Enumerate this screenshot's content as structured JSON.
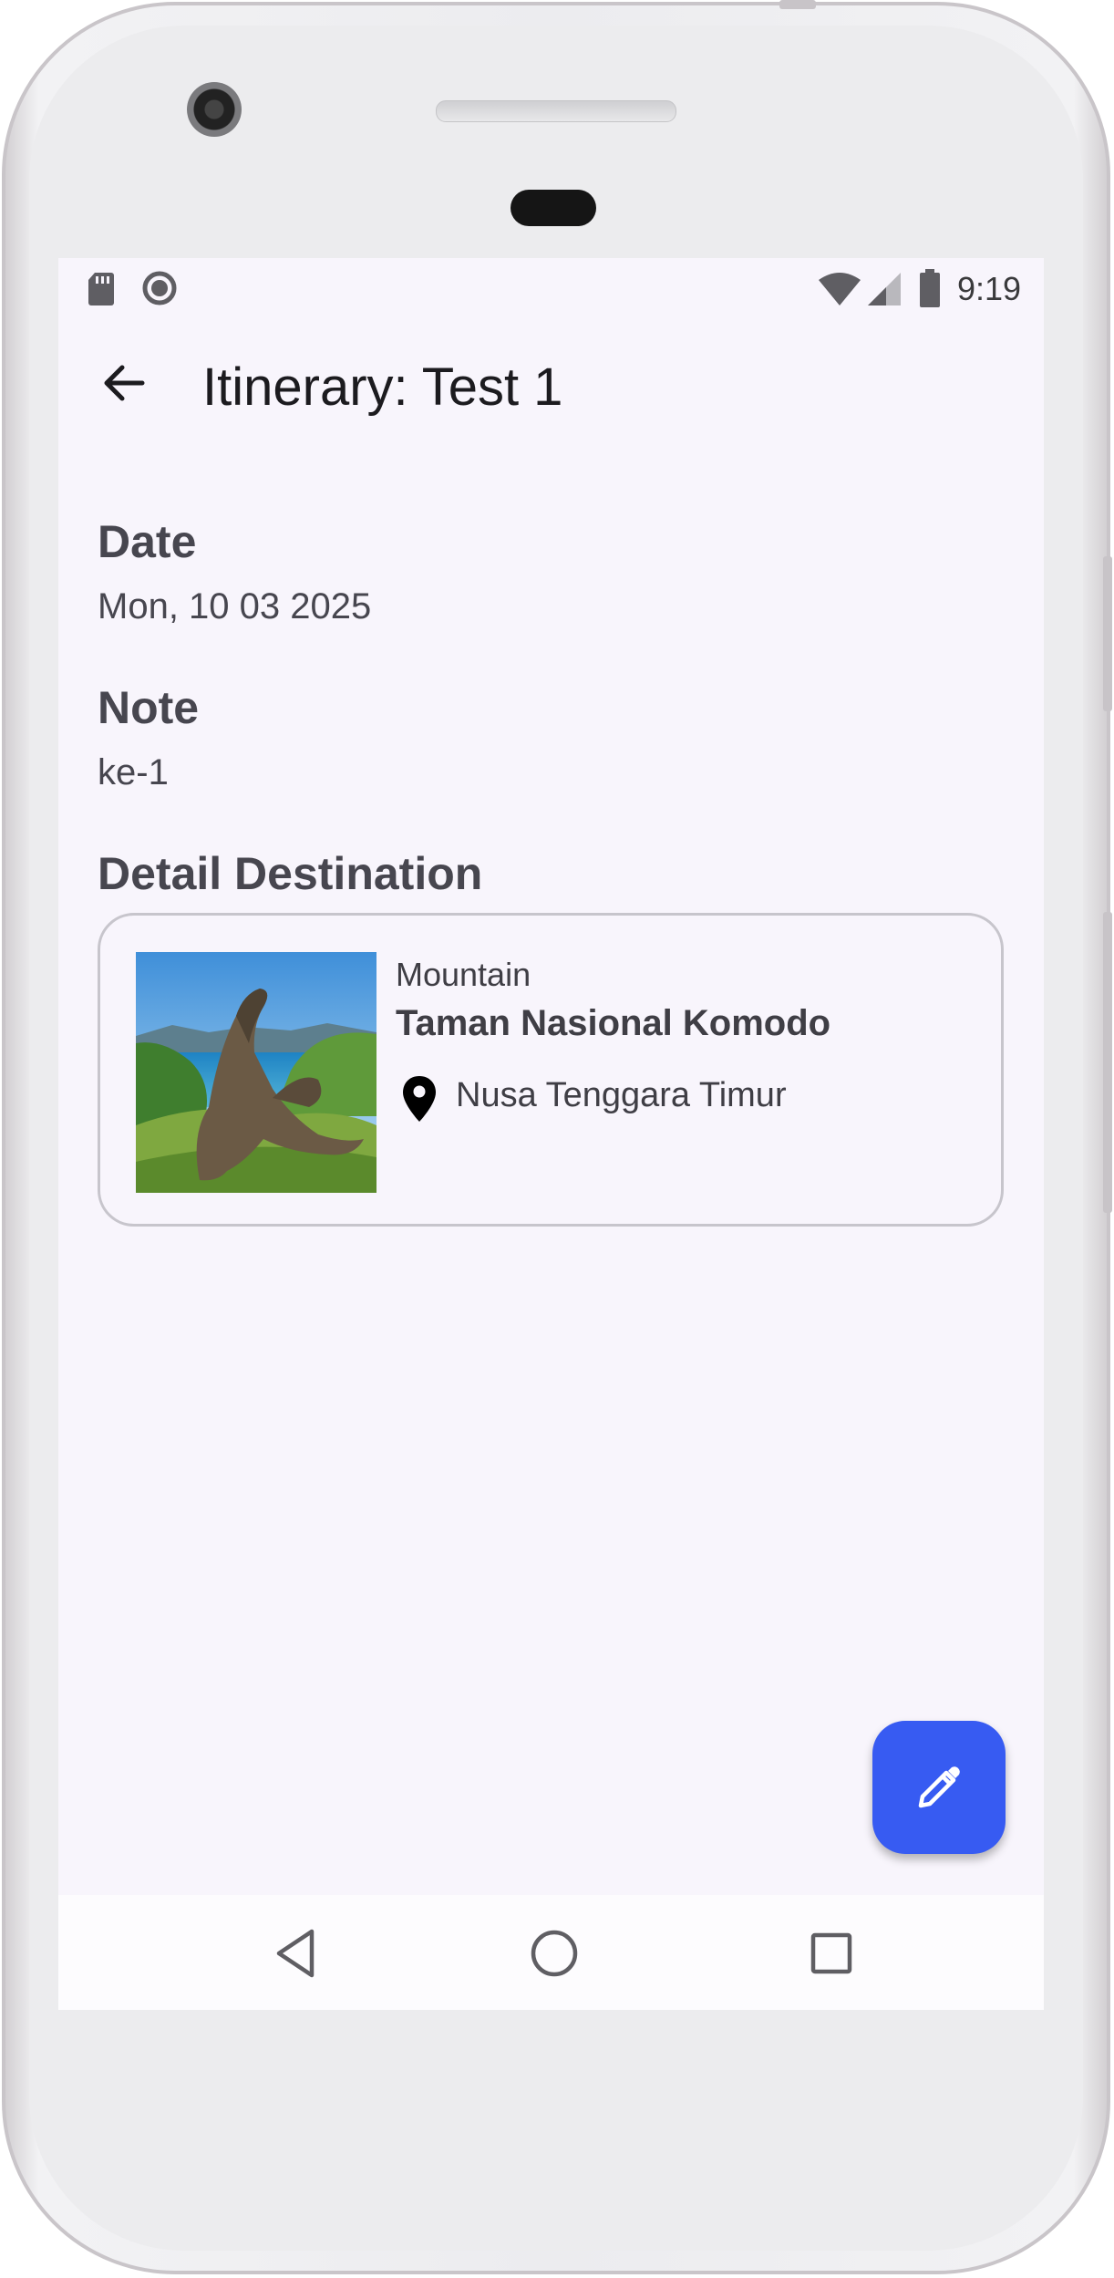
{
  "status_bar": {
    "time": "9:19"
  },
  "app_bar": {
    "title": "Itinerary: Test 1"
  },
  "date": {
    "label": "Date",
    "value": "Mon, 10 03 2025"
  },
  "note": {
    "label": "Note",
    "value": "ke-1"
  },
  "detail": {
    "label": "Detail Destination",
    "card": {
      "category": "Mountain",
      "name": "Taman Nasional Komodo",
      "location": "Nusa Tenggara Timur"
    }
  },
  "colors": {
    "fab": "#375bf2",
    "screen_background": "#f8f5fc",
    "label_text": "#47464f"
  },
  "icons": {
    "back": "arrow-back-icon",
    "location": "location-pin-icon",
    "edit": "pencil-edit-icon",
    "nav_back": "triangle-back-icon",
    "nav_home": "circle-home-icon",
    "nav_recents": "square-recents-icon"
  }
}
